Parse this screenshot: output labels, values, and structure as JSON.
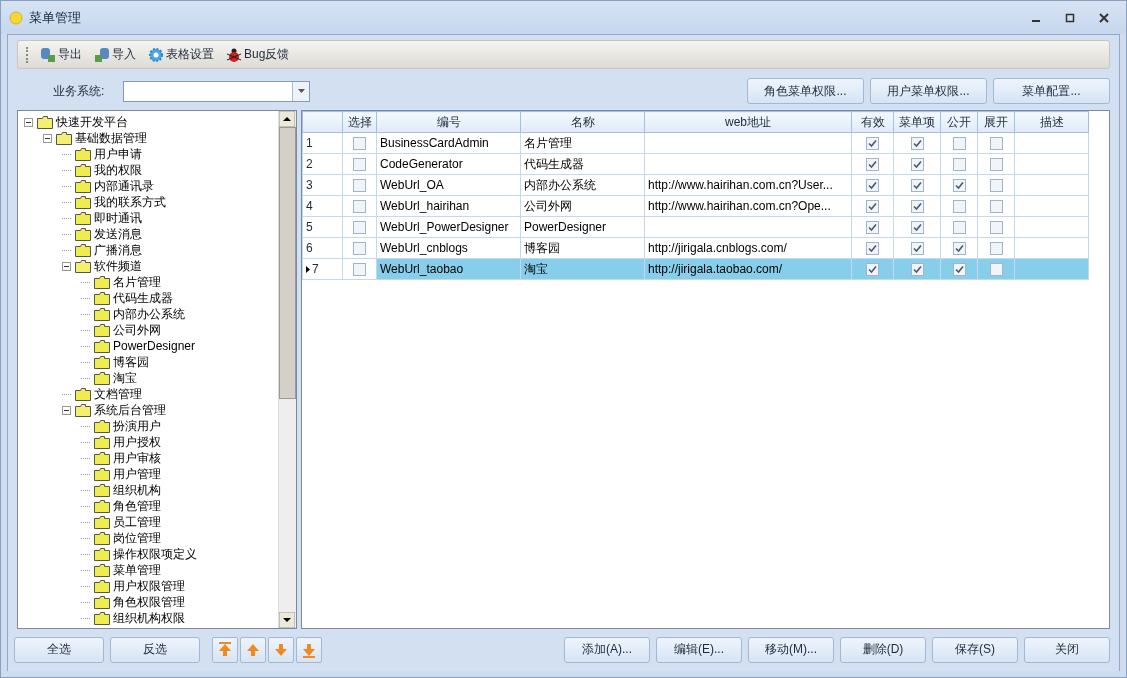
{
  "window": {
    "title": "菜单管理"
  },
  "toolbar": [
    {
      "kind": "export",
      "label": "导出"
    },
    {
      "kind": "import",
      "label": "导入"
    },
    {
      "kind": "settings",
      "label": "表格设置"
    },
    {
      "kind": "bug",
      "label": "Bug反馈"
    }
  ],
  "filter": {
    "label": "业务系统:"
  },
  "top_buttons": [
    "角色菜单权限...",
    "用户菜单权限...",
    "菜单配置..."
  ],
  "tree": [
    {
      "label": "快速开发平台",
      "expanded": true,
      "children": [
        {
          "label": "基础数据管理",
          "expanded": true,
          "children": [
            {
              "label": "用户申请"
            },
            {
              "label": "我的权限"
            },
            {
              "label": "内部通讯录"
            },
            {
              "label": "我的联系方式"
            },
            {
              "label": "即时通讯"
            },
            {
              "label": "发送消息"
            },
            {
              "label": "广播消息"
            },
            {
              "label": "软件频道",
              "expanded": true,
              "children": [
                {
                  "label": "名片管理"
                },
                {
                  "label": "代码生成器"
                },
                {
                  "label": "内部办公系统"
                },
                {
                  "label": "公司外网"
                },
                {
                  "label": "PowerDesigner"
                },
                {
                  "label": "博客园"
                },
                {
                  "label": "淘宝"
                }
              ]
            },
            {
              "label": "文档管理"
            },
            {
              "label": "系统后台管理",
              "expanded": true,
              "children": [
                {
                  "label": "扮演用户"
                },
                {
                  "label": "用户授权"
                },
                {
                  "label": "用户审核"
                },
                {
                  "label": "用户管理"
                },
                {
                  "label": "组织机构"
                },
                {
                  "label": "角色管理"
                },
                {
                  "label": "员工管理"
                },
                {
                  "label": "岗位管理"
                },
                {
                  "label": "操作权限项定义"
                },
                {
                  "label": "菜单管理"
                },
                {
                  "label": "用户权限管理"
                },
                {
                  "label": "角色权限管理"
                },
                {
                  "label": "组织机构权限"
                }
              ]
            }
          ]
        }
      ]
    }
  ],
  "table": {
    "columns": [
      "选择",
      "编号",
      "名称",
      "web地址",
      "有效",
      "菜单项",
      "公开",
      "展开",
      "描述"
    ],
    "rows": [
      {
        "number": "1",
        "selected": false,
        "checked": false,
        "code": "BusinessCardAdmin",
        "name": "名片管理",
        "valid": true,
        "menu_item": true,
        "public": false,
        "expand": false
      },
      {
        "number": "2",
        "selected": false,
        "checked": false,
        "code": "CodeGenerator",
        "name": "代码生成器",
        "valid": true,
        "menu_item": true,
        "public": false,
        "expand": false
      },
      {
        "number": "3",
        "selected": false,
        "checked": false,
        "code": "WebUrl_OA",
        "name": "内部办公系统",
        "url": "http://www.hairihan.com.cn?User...",
        "valid": true,
        "menu_item": true,
        "public": true,
        "expand": false
      },
      {
        "number": "4",
        "selected": false,
        "checked": false,
        "code": "WebUrl_hairihan",
        "name": "公司外网",
        "url": "http://www.hairihan.com.cn?Ope...",
        "valid": true,
        "menu_item": true,
        "public": false,
        "expand": false
      },
      {
        "number": "5",
        "selected": false,
        "checked": false,
        "code": "WebUrl_PowerDesigner",
        "name": "PowerDesigner",
        "valid": true,
        "menu_item": true,
        "public": false,
        "expand": false
      },
      {
        "number": "6",
        "selected": false,
        "checked": false,
        "code": "WebUrl_cnblogs",
        "name": "博客园",
        "url": "http://jirigala.cnblogs.com/",
        "valid": true,
        "menu_item": true,
        "public": true,
        "expand": false
      },
      {
        "number": "7",
        "selected": true,
        "checked": false,
        "code": "WebUrl_taobao",
        "name": "淘宝",
        "url": "http://jirigala.taobao.com/",
        "valid": true,
        "menu_item": true,
        "public": true,
        "expand": false
      }
    ]
  },
  "bottom_left_buttons": [
    "全选",
    "反选"
  ],
  "move_buttons": [
    {
      "kind": "top"
    },
    {
      "kind": "up"
    },
    {
      "kind": "down"
    },
    {
      "kind": "bottom"
    }
  ],
  "bottom_buttons": [
    "添加(A)...",
    "编辑(E)...",
    "移动(M)...",
    "删除(D)",
    "保存(S)",
    "关闭"
  ]
}
